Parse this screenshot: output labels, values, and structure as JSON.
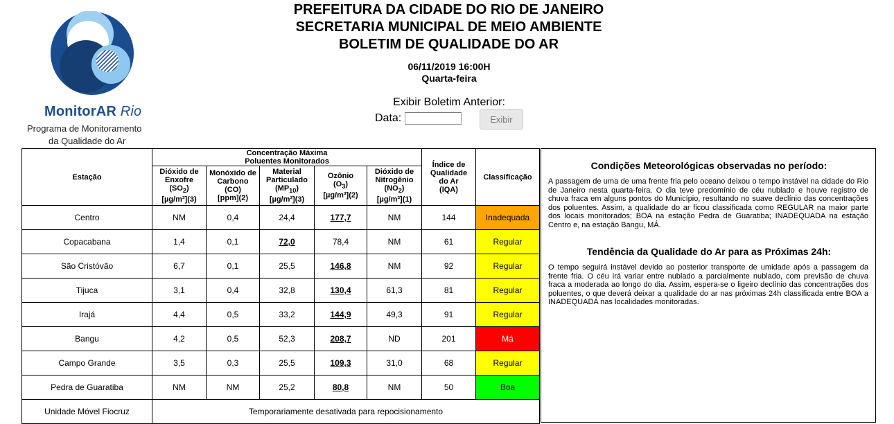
{
  "logo": {
    "brand_bold": "MonitorAR",
    "brand_italic": "Rio",
    "subtitle_line1": "Programa de Monitoramento",
    "subtitle_line2": "da Qualidade do Ar"
  },
  "header": {
    "line1": "PREFEITURA DA CIDADE DO RIO DE JANEIRO",
    "line2": "SECRETARIA MUNICIPAL DE MEIO AMBIENTE",
    "line3": "BOLETIM DE QUALIDADE DO AR",
    "datetime": "06/11/2019 16:00H",
    "weekday": "Quarta-feira"
  },
  "previous": {
    "label": "Exibir Boletim Anterior:",
    "date_label": "Data:",
    "date_value": "",
    "button_label": "Exibir"
  },
  "table": {
    "station_header": "Estação",
    "group_header_line1": "Concentração Máxima",
    "group_header_line2": "Poluentes Monitorados",
    "pollutants": [
      {
        "l1": "Dióxido de",
        "l2": "Enxofre",
        "sym": "SO",
        "sub": "2",
        "unit": "[µg/m³](3)"
      },
      {
        "l1": "Monóxido de",
        "l2": "Carbono",
        "sym": "CO",
        "sub": "",
        "unit": "[ppm](2)"
      },
      {
        "l1": "Material",
        "l2": "Particulado",
        "sym": "MP",
        "sub": "10",
        "unit": "[µg/m³](3)"
      },
      {
        "l1": "Ozônio",
        "l2": "",
        "sym": "O",
        "sub": "3",
        "unit": "[µg/m³](2)"
      },
      {
        "l1": "Dióxido de",
        "l2": "Nitrogênio",
        "sym": "NO",
        "sub": "2",
        "unit": "[µg/m³](1)"
      }
    ],
    "iqa_header": [
      "Índice de",
      "Qualidade",
      "do Ar",
      "(IQA)"
    ],
    "class_header": "Classificação",
    "rows": [
      {
        "station": "Centro",
        "so2": "NM",
        "co": "0,4",
        "mp10": "24,4",
        "o3": "177,7",
        "no2": "NM",
        "iqa": "144",
        "class": "Inadequada"
      },
      {
        "station": "Copacabana",
        "so2": "1,4",
        "co": "0,1",
        "mp10": "72,0",
        "o3": "78,4",
        "no2": "NM",
        "iqa": "61",
        "class": "Regular"
      },
      {
        "station": "São Cristóvão",
        "so2": "6,7",
        "co": "0,1",
        "mp10": "25,5",
        "o3": "146,8",
        "no2": "NM",
        "iqa": "92",
        "class": "Regular"
      },
      {
        "station": "Tijuca",
        "so2": "3,1",
        "co": "0,4",
        "mp10": "32,8",
        "o3": "130,4",
        "no2": "61,3",
        "iqa": "81",
        "class": "Regular"
      },
      {
        "station": "Irajá",
        "so2": "4,4",
        "co": "0,5",
        "mp10": "33,2",
        "o3": "144,9",
        "no2": "49,3",
        "iqa": "91",
        "class": "Regular"
      },
      {
        "station": "Bangu",
        "so2": "4,2",
        "co": "0,5",
        "mp10": "52,3",
        "o3": "208,7",
        "no2": "ND",
        "iqa": "201",
        "class": "Má"
      },
      {
        "station": "Campo Grande",
        "so2": "3,5",
        "co": "0,3",
        "mp10": "25,5",
        "o3": "109,3",
        "no2": "31,0",
        "iqa": "68",
        "class": "Regular"
      },
      {
        "station": "Pedra de Guaratiba",
        "so2": "NM",
        "co": "NM",
        "mp10": "25,2",
        "o3": "80,8",
        "no2": "NM",
        "iqa": "50",
        "class": "Boa"
      }
    ],
    "last_row": {
      "station": "Unidade Móvel Fiocruz",
      "note": "Temporariamente desativada para repocisionamento"
    },
    "colors": {
      "Inadequada": "#ffa500",
      "Regular": "#ffff00",
      "Má": "#ff0000",
      "Boa": "#00ff00"
    }
  },
  "conditions": {
    "title1": "Condições Meteorológicas observadas no período:",
    "text1": "A passagem de uma de uma frente fria pelo oceano deixou o tempo instável na cidade do Rio de Janeiro nesta quarta-feira. O dia teve predomínio de céu nublado e houve registro de chuva fraca em alguns pontos do Município, resultando no suave declínio das concentrações dos poluentes. Assim, a qualidade do ar ficou classificada como REGULAR na maior parte dos locais monitorados; BOA na estação Pedra de Guaratiba; INADEQUADA na estação Centro e, na estação Bangu, MÁ.",
    "title2": "Tendência da Qualidade do Ar para as Próximas 24h:",
    "text2": "O tempo seguirá instável devido ao posterior transporte de umidade após a passagem da frente fria. O céu irá variar entre nublado a parcialmente nublado, com previsão de chuva fraca a moderada ao longo do dia. Assim, espera-se o ligeiro declínio das concentrações dos poluentes, o que deverá deixar a qualidade do ar nas próximas 24h classificada entre BOA a INADEQUADA nas localidades monitoradas."
  }
}
